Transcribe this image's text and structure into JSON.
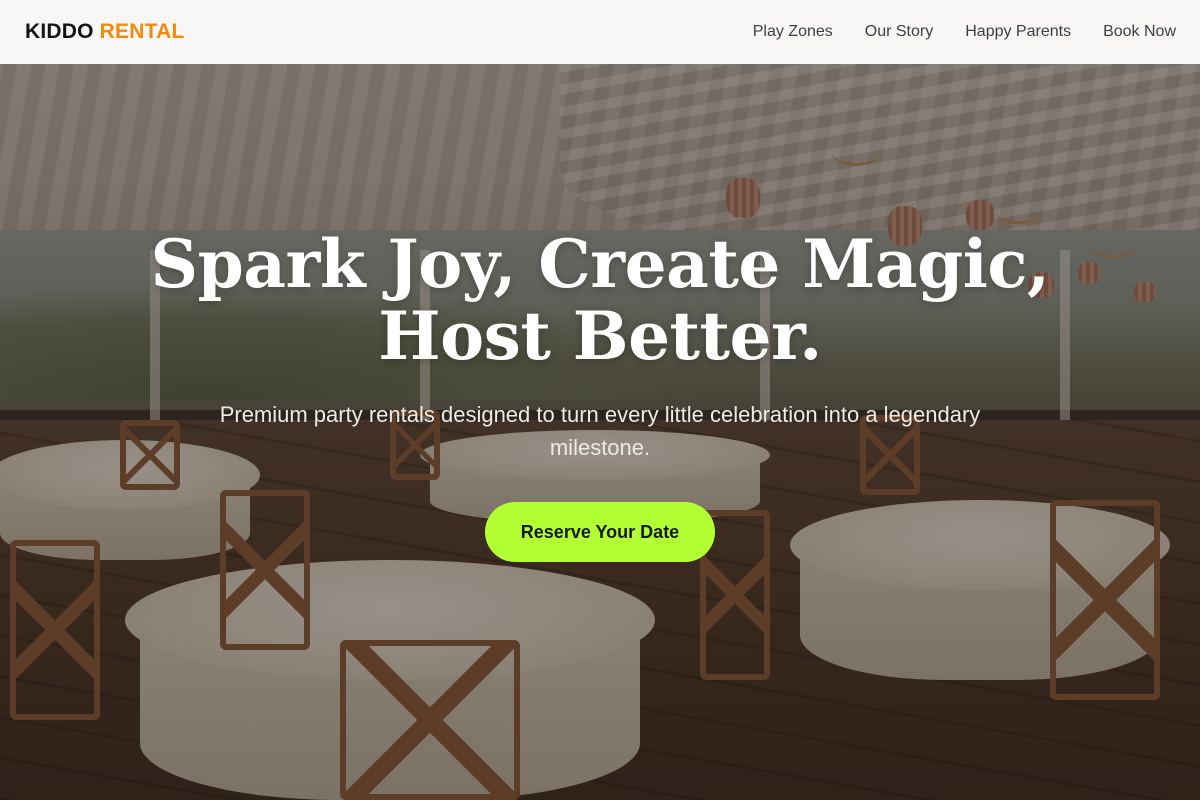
{
  "brand": {
    "name_part_1": "KIDDO",
    "name_part_2": "RENTAL",
    "colors": {
      "dark": "#141414",
      "accent": "#f28a0c"
    }
  },
  "nav": {
    "items": [
      {
        "label": "Play Zones"
      },
      {
        "label": "Our Story"
      },
      {
        "label": "Happy Parents"
      },
      {
        "label": "Book Now"
      }
    ]
  },
  "hero": {
    "title_line_1": "Spark Joy, Create Magic,",
    "title_line_2": "Host Better.",
    "subtitle": "Premium party rentals designed to turn every little celebration into a legendary milestone.",
    "cta_label": "Reserve Your Date",
    "cta_color": "#b2ff33",
    "background_image": "event-tent-dining-photo"
  }
}
